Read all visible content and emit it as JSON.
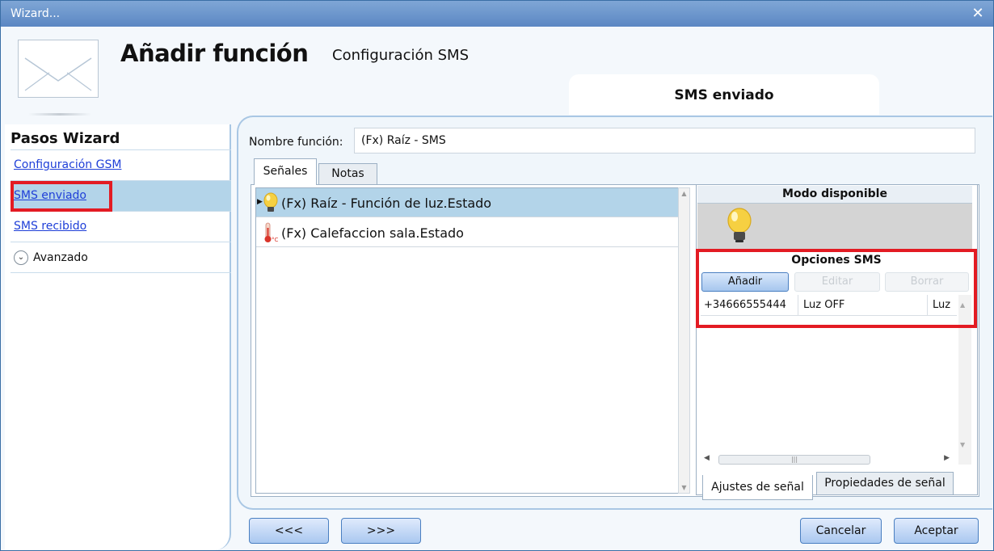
{
  "window": {
    "title": "Wizard...",
    "close_icon": "close-icon"
  },
  "header": {
    "title": "Añadir función",
    "subtitle": "Configuración SMS",
    "section_tab": "SMS enviado"
  },
  "sidebar": {
    "title": "Pasos Wizard",
    "items": [
      {
        "label": "Configuración GSM",
        "selected": false
      },
      {
        "label": "SMS enviado",
        "selected": true
      },
      {
        "label": "SMS recibido",
        "selected": false
      }
    ],
    "advanced": "Avanzado"
  },
  "form": {
    "name_label": "Nombre función:",
    "name_value": "(Fx) Raíz - SMS"
  },
  "tabs": {
    "signals": "Señales",
    "notes": "Notas"
  },
  "signals": [
    {
      "label": "(Fx) Raíz - Función de luz.Estado",
      "icon": "bulb-icon",
      "selected": true
    },
    {
      "label": "(Fx) Calefaccion sala.Estado",
      "icon": "thermometer-icon",
      "selected": false
    }
  ],
  "right": {
    "modo_title": "Modo disponible",
    "options_title": "Opciones SMS",
    "buttons": {
      "add": "Añadir",
      "edit": "Editar",
      "delete": "Borrar"
    },
    "row": {
      "phone": "+34666555444",
      "message": "Luz OFF",
      "extra": "Luz"
    },
    "tabs": {
      "settings": "Ajustes de señal",
      "properties": "Propiedades de señal"
    }
  },
  "footer": {
    "prev": "<<<",
    "next": ">>>",
    "cancel": "Cancelar",
    "accept": "Aceptar"
  },
  "colors": {
    "highlight": "#e31b23",
    "selection": "#b3d4e9",
    "titlebar": "#5b87c3"
  }
}
